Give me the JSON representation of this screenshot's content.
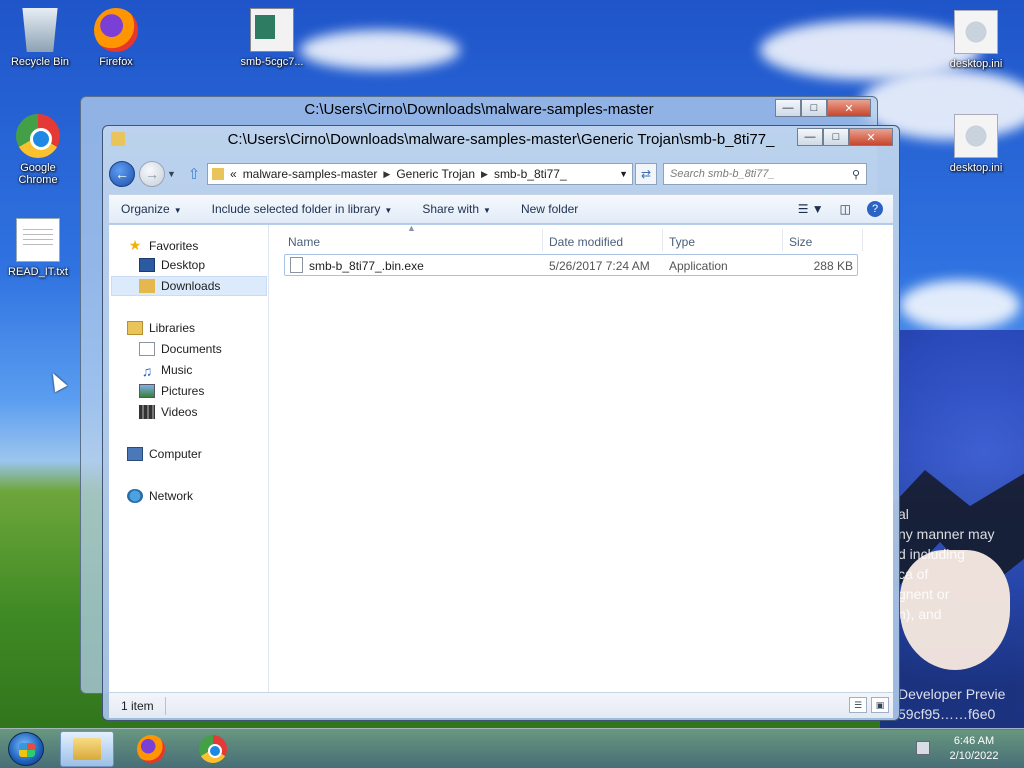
{
  "desktop": {
    "icons": [
      {
        "label": "Recycle Bin",
        "icon": "recycle-bin-icon"
      },
      {
        "label": "Firefox",
        "icon": "firefox-icon"
      },
      {
        "label": "smb-5cgc7...",
        "icon": "image-file-icon"
      },
      {
        "label": "desktop.ini",
        "icon": "settings-file-icon"
      },
      {
        "label": "Google Chrome",
        "icon": "chrome-icon"
      },
      {
        "label": "desktop.ini",
        "icon": "settings-file-icon"
      },
      {
        "label": "READ_IT.txt",
        "icon": "text-file-icon"
      }
    ],
    "watermark_lines": [
      "al",
      "ny manner may",
      "d including",
      "ca of",
      "gnent or",
      "n), and",
      "Developer Previe",
      "59cf95……f6e0"
    ]
  },
  "back_window": {
    "title": "C:\\Users\\Cirno\\Downloads\\malware-samples-master"
  },
  "window": {
    "title": "C:\\Users\\Cirno\\Downloads\\malware-samples-master\\Generic Trojan\\smb-b_8ti77_",
    "breadcrumb": [
      "malware-samples-master",
      "Generic Trojan",
      "smb-b_8ti77_"
    ],
    "breadcrumb_prefix": "«",
    "search_placeholder": "Search smb-b_8ti77_",
    "toolbar": {
      "organize": "Organize",
      "include": "Include selected folder in library",
      "share": "Share with",
      "new_folder": "New folder"
    },
    "nav": {
      "favorites": "Favorites",
      "desktop": "Desktop",
      "downloads": "Downloads",
      "libraries": "Libraries",
      "documents": "Documents",
      "music": "Music",
      "pictures": "Pictures",
      "videos": "Videos",
      "computer": "Computer",
      "network": "Network"
    },
    "columns": {
      "name": "Name",
      "date": "Date modified",
      "type": "Type",
      "size": "Size"
    },
    "files": [
      {
        "name": "smb-b_8ti77_.bin.exe",
        "date": "5/26/2017 7:24 AM",
        "type": "Application",
        "size": "288 KB"
      }
    ],
    "status": {
      "count": "1 item"
    }
  },
  "taskbar": {
    "apps": [
      "file-explorer-icon",
      "firefox-icon",
      "chrome-icon"
    ],
    "time": "6:46 AM",
    "date": "2/10/2022"
  },
  "colors": {
    "selection": "#dcebfc",
    "desktop_sky": "#2f72e0",
    "desktop_grass": "#3f8a25"
  }
}
